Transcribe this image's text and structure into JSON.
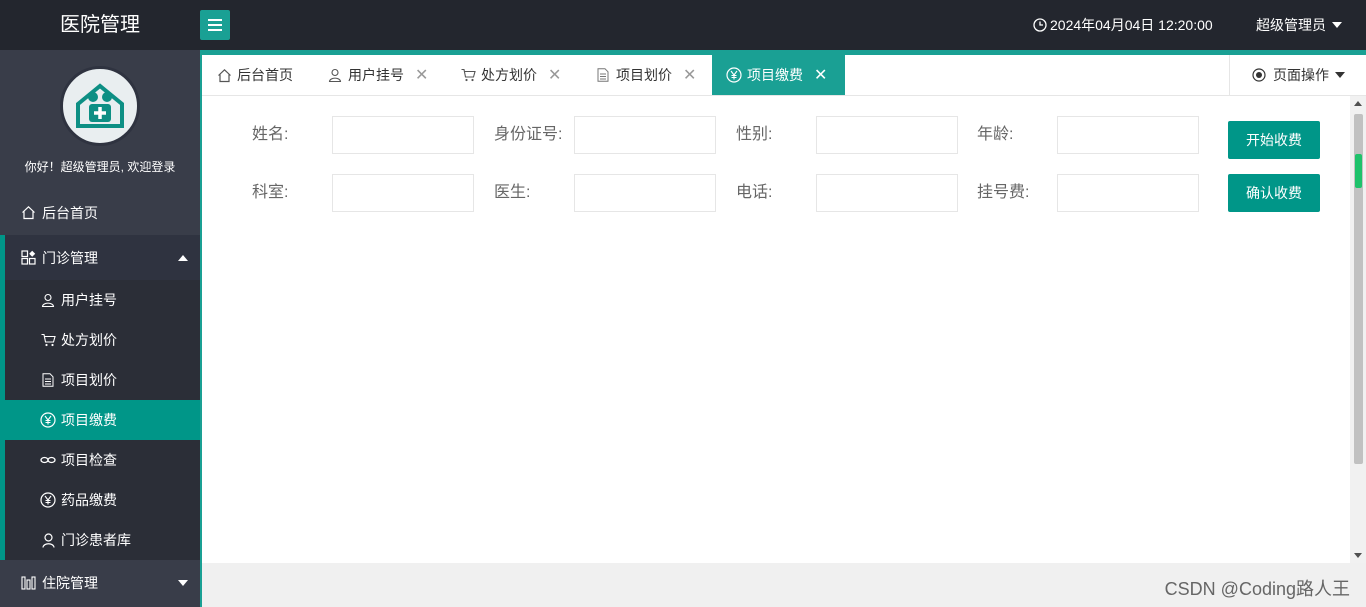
{
  "app": {
    "title": "医院管理"
  },
  "header": {
    "datetime": "2024年04月04日 12:20:00",
    "user": "超级管理员"
  },
  "sidebar": {
    "welcome": "你好！超级管理员, 欢迎登录",
    "home": "后台首页",
    "outpatient": {
      "label": "门诊管理",
      "items": [
        {
          "label": "用户挂号",
          "icon": "user-icon"
        },
        {
          "label": "处方划价",
          "icon": "cart-icon"
        },
        {
          "label": "项目划价",
          "icon": "document-icon"
        },
        {
          "label": "项目缴费",
          "icon": "yen-icon"
        },
        {
          "label": "项目检查",
          "icon": "link-icon"
        },
        {
          "label": "药品缴费",
          "icon": "yen-icon"
        },
        {
          "label": "门诊患者库",
          "icon": "person-icon"
        }
      ]
    },
    "inpatient": {
      "label": "住院管理"
    }
  },
  "tabs": [
    {
      "label": "后台首页",
      "icon": "home-icon",
      "closable": false
    },
    {
      "label": "用户挂号",
      "icon": "user-icon",
      "closable": true
    },
    {
      "label": "处方划价",
      "icon": "cart-icon",
      "closable": true
    },
    {
      "label": "项目划价",
      "icon": "document-icon",
      "closable": true
    },
    {
      "label": "项目缴费",
      "icon": "yen-icon",
      "closable": true,
      "active": true
    }
  ],
  "page_ops": "页面操作",
  "form": {
    "name": "姓名:",
    "id_number": "身份证号:",
    "gender": "性别:",
    "age": "年龄:",
    "department": "科室:",
    "doctor": "医生:",
    "phone": "电话:",
    "registration_fee": "挂号费:",
    "start_charge": "开始收费",
    "confirm_charge": "确认收费"
  },
  "watermark": "CSDN @Coding路人王",
  "colors": {
    "accent": "#009688",
    "topbar": "#23262e",
    "sidebar": "#393d49"
  }
}
